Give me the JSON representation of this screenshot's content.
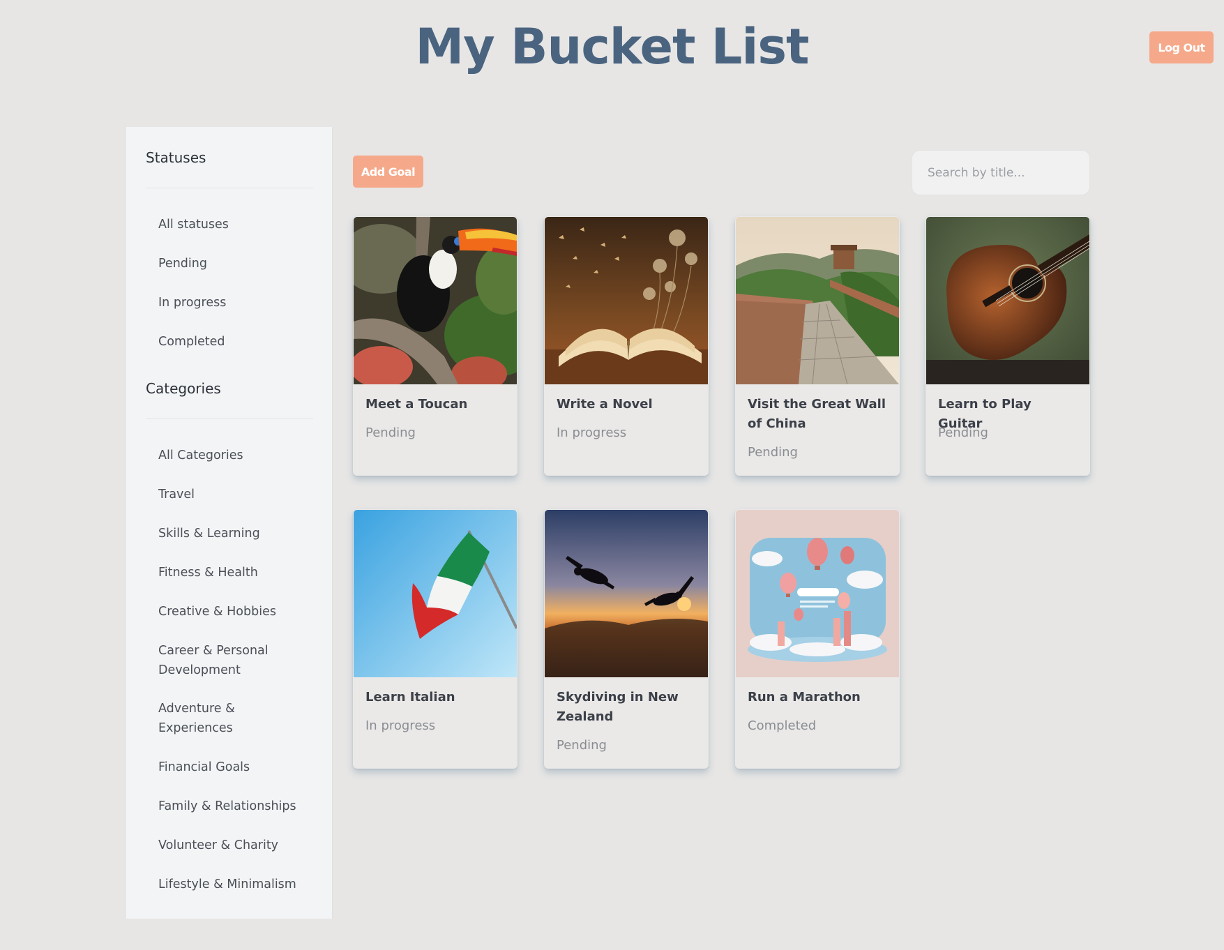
{
  "header": {
    "title": "My Bucket List",
    "logout_label": "Log Out"
  },
  "toolbar": {
    "add_goal_label": "Add Goal",
    "search_placeholder": "Search by title..."
  },
  "sidebar": {
    "statuses_heading": "Statuses",
    "statuses": [
      "All statuses",
      "Pending",
      "In progress",
      "Completed"
    ],
    "categories_heading": "Categories",
    "categories": [
      "All Categories",
      "Travel",
      "Skills & Learning",
      "Fitness & Health",
      "Creative & Hobbies",
      "Career & Personal Development",
      "Adventure & Experiences",
      "Financial Goals",
      "Family & Relationships",
      "Volunteer & Charity",
      "Lifestyle & Minimalism"
    ]
  },
  "goals": [
    {
      "title": "Meet a Toucan",
      "status": "Pending",
      "image": "toucan-photo"
    },
    {
      "title": "Write a Novel",
      "status": "In progress",
      "image": "open-book-photo"
    },
    {
      "title": "Visit the Great Wall of China",
      "status": "Pending",
      "image": "great-wall-photo"
    },
    {
      "title": "Learn to Play Guitar",
      "status": "Pending",
      "image": "acoustic-guitar-photo"
    },
    {
      "title": "Learn Italian",
      "status": "In progress",
      "image": "italian-flag-photo"
    },
    {
      "title": "Skydiving in New Zealand",
      "status": "Pending",
      "image": "skydivers-sunset-photo"
    },
    {
      "title": "Run a Marathon",
      "status": "Completed",
      "image": "hot-air-balloons-illustration"
    }
  ],
  "colors": {
    "accent": "#f5a98a",
    "title": "#4a6480",
    "background": "#e7e6e5",
    "sidebar": "#f3f4f5"
  }
}
